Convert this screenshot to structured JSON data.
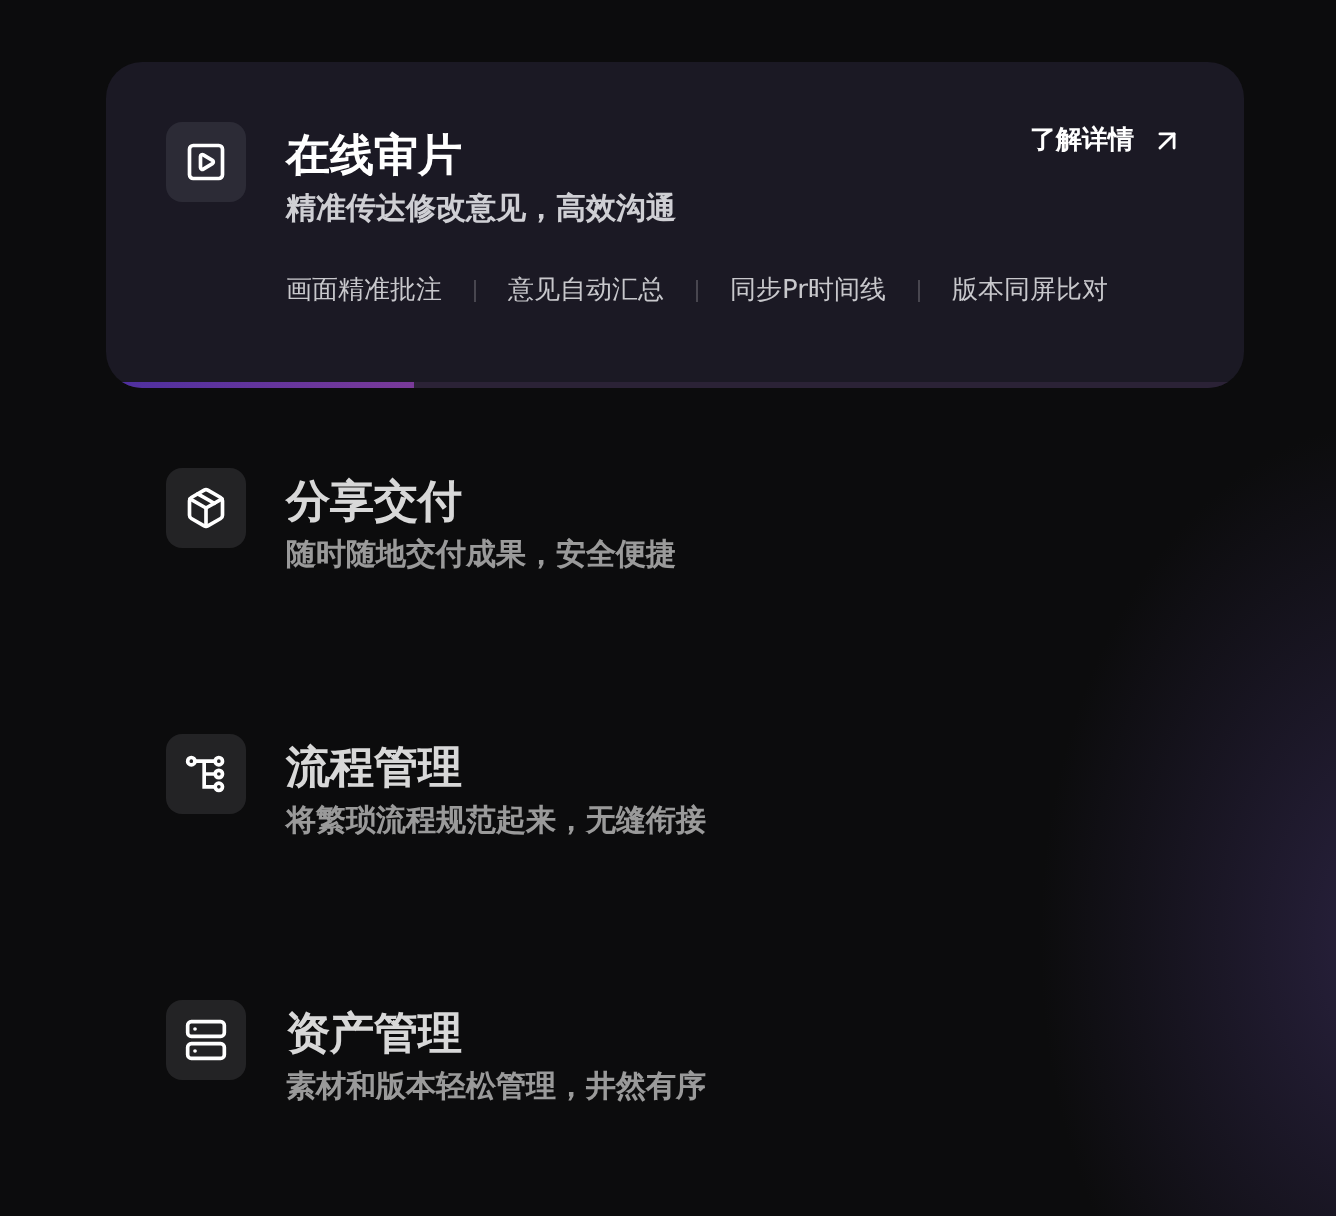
{
  "features": [
    {
      "title": "在线审片",
      "subtitle": "精准传达修改意见，高效沟通",
      "selected": true,
      "link": "了解详情",
      "tags": [
        "画面精准批注",
        "意见自动汇总",
        "同步Pr时间线",
        "版本同屏比对"
      ],
      "level": 0.27
    },
    {
      "title": "分享交付",
      "subtitle": "随时随地交付成果，安全便捷",
      "selected": false
    },
    {
      "title": "流程管理",
      "subtitle": "将繁琐流程规范起来，无缝衔接",
      "selected": false
    },
    {
      "title": "资产管理",
      "subtitle": "素材和版本轻松管理，井然有序",
      "selected": false
    }
  ]
}
